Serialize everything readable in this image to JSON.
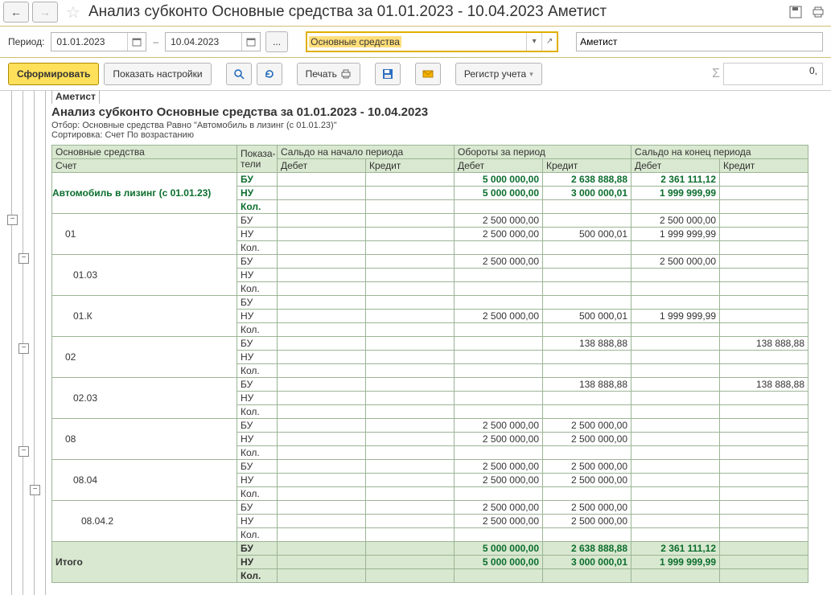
{
  "title": "Анализ субконто Основные средства за 01.01.2023 - 10.04.2023 Аметист",
  "period": {
    "label": "Период:",
    "from": "01.01.2023",
    "to": "10.04.2023",
    "ellipsis": "..."
  },
  "subconto": {
    "value": "Основные средства"
  },
  "org_field": "Аметист",
  "actions": {
    "form": "Сформировать",
    "show_settings": "Показать настройки",
    "print": "Печать",
    "register": "Регистр учета"
  },
  "sigma_value": "0,",
  "report": {
    "org": "Аметист",
    "title": "Анализ субконто Основные средства за 01.01.2023 - 10.04.2023",
    "filter": "Отбор: Основные средства Равно \"Автомобиль в лизинг (с 01.01.23)\"",
    "sort": "Сортировка: Счет По возрастанию",
    "hdr": {
      "subconto": "Основные средства",
      "account": "Счет",
      "ind": "Показа-\nтели",
      "begin": "Сальдо на начало периода",
      "turn": "Обороты за период",
      "end": "Сальдо на конец периода",
      "debit": "Дебет",
      "credit": "Кредит"
    },
    "ind_labels": {
      "bu": "БУ",
      "nu": "НУ",
      "kol": "Кол."
    },
    "rows": [
      {
        "name": "Автомобиль в лизинг (с 01.01.23)",
        "bold": true,
        "green": true,
        "style": "subconto",
        "bu": {
          "bd": "",
          "bc": "",
          "td": "5 000 000,00",
          "tc": "2 638 888,88",
          "ed": "2 361 111,12",
          "ec": ""
        },
        "nu": {
          "bd": "",
          "bc": "",
          "td": "5 000 000,00",
          "tc": "3 000 000,01",
          "ed": "1 999 999,99",
          "ec": ""
        },
        "kol": {
          "bd": "",
          "bc": "",
          "td": "",
          "tc": "",
          "ed": "",
          "ec": ""
        }
      },
      {
        "name": "01",
        "indent": 1,
        "bu": {
          "bd": "",
          "bc": "",
          "td": "2 500 000,00",
          "tc": "",
          "ed": "2 500 000,00",
          "ec": ""
        },
        "nu": {
          "bd": "",
          "bc": "",
          "td": "2 500 000,00",
          "tc": "500 000,01",
          "ed": "1 999 999,99",
          "ec": ""
        },
        "kol": {
          "bd": "",
          "bc": "",
          "td": "",
          "tc": "",
          "ed": "",
          "ec": ""
        }
      },
      {
        "name": "01.03",
        "indent": 2,
        "bu": {
          "bd": "",
          "bc": "",
          "td": "2 500 000,00",
          "tc": "",
          "ed": "2 500 000,00",
          "ec": ""
        },
        "nu": {
          "bd": "",
          "bc": "",
          "td": "",
          "tc": "",
          "ed": "",
          "ec": ""
        },
        "kol": {
          "bd": "",
          "bc": "",
          "td": "",
          "tc": "",
          "ed": "",
          "ec": ""
        }
      },
      {
        "name": "01.К",
        "indent": 2,
        "bu": {
          "bd": "",
          "bc": "",
          "td": "",
          "tc": "",
          "ed": "",
          "ec": ""
        },
        "nu": {
          "bd": "",
          "bc": "",
          "td": "2 500 000,00",
          "tc": "500 000,01",
          "ed": "1 999 999,99",
          "ec": ""
        },
        "kol": {
          "bd": "",
          "bc": "",
          "td": "",
          "tc": "",
          "ed": "",
          "ec": ""
        }
      },
      {
        "name": "02",
        "indent": 1,
        "bu": {
          "bd": "",
          "bc": "",
          "td": "",
          "tc": "138 888,88",
          "ed": "",
          "ec": "138 888,88"
        },
        "nu": {
          "bd": "",
          "bc": "",
          "td": "",
          "tc": "",
          "ed": "",
          "ec": ""
        },
        "kol": {
          "bd": "",
          "bc": "",
          "td": "",
          "tc": "",
          "ed": "",
          "ec": ""
        }
      },
      {
        "name": "02.03",
        "indent": 2,
        "bu": {
          "bd": "",
          "bc": "",
          "td": "",
          "tc": "138 888,88",
          "ed": "",
          "ec": "138 888,88"
        },
        "nu": {
          "bd": "",
          "bc": "",
          "td": "",
          "tc": "",
          "ed": "",
          "ec": ""
        },
        "kol": {
          "bd": "",
          "bc": "",
          "td": "",
          "tc": "",
          "ed": "",
          "ec": ""
        }
      },
      {
        "name": "08",
        "indent": 1,
        "bu": {
          "bd": "",
          "bc": "",
          "td": "2 500 000,00",
          "tc": "2 500 000,00",
          "ed": "",
          "ec": ""
        },
        "nu": {
          "bd": "",
          "bc": "",
          "td": "2 500 000,00",
          "tc": "2 500 000,00",
          "ed": "",
          "ec": ""
        },
        "kol": {
          "bd": "",
          "bc": "",
          "td": "",
          "tc": "",
          "ed": "",
          "ec": ""
        }
      },
      {
        "name": "08.04",
        "indent": 2,
        "bu": {
          "bd": "",
          "bc": "",
          "td": "2 500 000,00",
          "tc": "2 500 000,00",
          "ed": "",
          "ec": ""
        },
        "nu": {
          "bd": "",
          "bc": "",
          "td": "2 500 000,00",
          "tc": "2 500 000,00",
          "ed": "",
          "ec": ""
        },
        "kol": {
          "bd": "",
          "bc": "",
          "td": "",
          "tc": "",
          "ed": "",
          "ec": ""
        }
      },
      {
        "name": "08.04.2",
        "indent": 3,
        "bu": {
          "bd": "",
          "bc": "",
          "td": "2 500 000,00",
          "tc": "2 500 000,00",
          "ed": "",
          "ec": ""
        },
        "nu": {
          "bd": "",
          "bc": "",
          "td": "2 500 000,00",
          "tc": "2 500 000,00",
          "ed": "",
          "ec": ""
        },
        "kol": {
          "bd": "",
          "bc": "",
          "td": "",
          "tc": "",
          "ed": "",
          "ec": ""
        }
      }
    ],
    "total": {
      "label": "Итого",
      "bu": {
        "bd": "",
        "bc": "",
        "td": "5 000 000,00",
        "tc": "2 638 888,88",
        "ed": "2 361 111,12",
        "ec": ""
      },
      "nu": {
        "bd": "",
        "bc": "",
        "td": "5 000 000,00",
        "tc": "3 000 000,01",
        "ed": "1 999 999,99",
        "ec": ""
      },
      "kol": {
        "bd": "",
        "bc": "",
        "td": "",
        "tc": "",
        "ed": "",
        "ec": ""
      }
    }
  }
}
